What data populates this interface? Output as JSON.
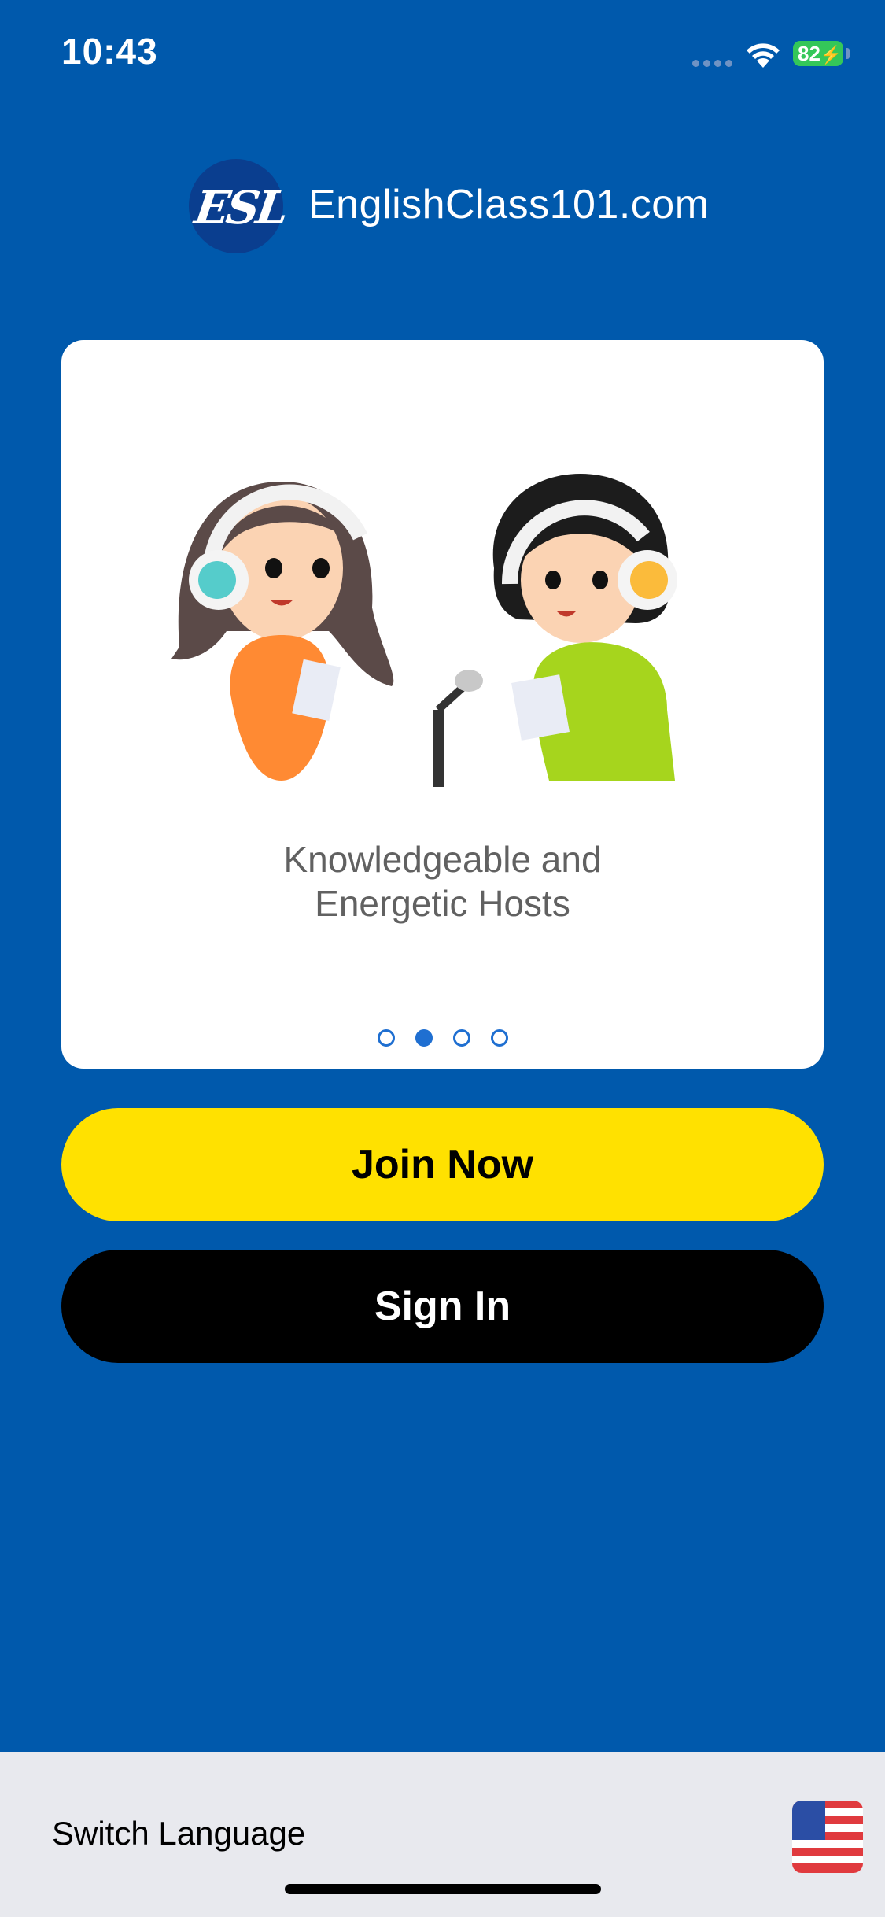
{
  "status_bar": {
    "time": "10:43",
    "battery": "82"
  },
  "brand": {
    "logo_mark": "ESL",
    "name": "EnglishClass101.com"
  },
  "carousel": {
    "caption": "Knowledgeable and Energetic Hosts",
    "pages": 4,
    "active_index": 1
  },
  "buttons": {
    "join": "Join Now",
    "sign_in": "Sign In"
  },
  "footer": {
    "switch_language": "Switch Language",
    "flag_icon": "us-flag-icon"
  },
  "colors": {
    "background": "#0059ac",
    "join_button": "#ffe100",
    "sign_in_button": "#000000",
    "footer": "#e8e9ee",
    "dot_active": "#1f6fd1"
  }
}
